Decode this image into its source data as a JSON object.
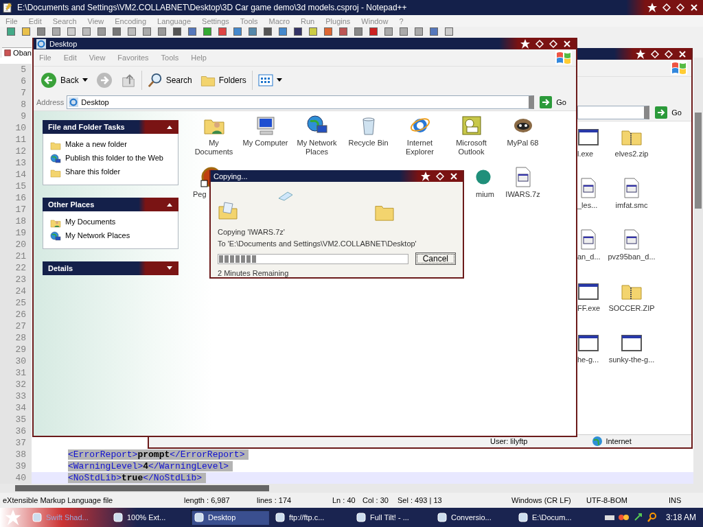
{
  "notepad": {
    "title": "E:\\Documents and Settings\\VM2.COLLABNET\\Desktop\\3D Car game demo\\3d models.csproj - Notepad++",
    "menu": [
      "File",
      "Edit",
      "Search",
      "View",
      "Encoding",
      "Language",
      "Settings",
      "Tools",
      "Macro",
      "Run",
      "Plugins",
      "Window",
      "?"
    ],
    "tab": "Oban",
    "lines": [
      {
        "number": "5",
        "current": false
      },
      {
        "number": "6",
        "current": false
      },
      {
        "number": "7",
        "current": false
      },
      {
        "number": "8",
        "current": false
      },
      {
        "number": "9",
        "current": false
      },
      {
        "number": "10",
        "current": false
      },
      {
        "number": "11",
        "current": false
      },
      {
        "number": "12",
        "current": false
      },
      {
        "number": "13",
        "current": false
      },
      {
        "number": "14",
        "current": false
      },
      {
        "number": "15",
        "current": false
      },
      {
        "number": "16",
        "current": false
      },
      {
        "number": "17",
        "current": false
      },
      {
        "number": "18",
        "current": false
      },
      {
        "number": "19",
        "current": false
      },
      {
        "number": "20",
        "current": false
      },
      {
        "number": "21",
        "current": false
      },
      {
        "number": "22",
        "current": false
      },
      {
        "number": "23",
        "current": false
      },
      {
        "number": "24",
        "current": false
      },
      {
        "number": "25",
        "current": false
      },
      {
        "number": "26",
        "current": false
      },
      {
        "number": "27",
        "current": false
      },
      {
        "number": "28",
        "current": false
      },
      {
        "number": "29",
        "current": false
      },
      {
        "number": "30",
        "current": false
      },
      {
        "number": "31",
        "current": false
      },
      {
        "number": "32",
        "current": false
      },
      {
        "number": "33",
        "current": false
      },
      {
        "number": "34",
        "current": false
      },
      {
        "number": "35",
        "current": false
      },
      {
        "number": "36",
        "current": false
      },
      {
        "number": "37",
        "current": false
      },
      {
        "number": "38",
        "selected": true,
        "current": false,
        "open_tag": "<ErrorReport>",
        "value": "prompt",
        "close_tag": "</ErrorReport>"
      },
      {
        "number": "39",
        "selected": true,
        "current": false,
        "open_tag": "<WarningLevel>",
        "value": "4",
        "close_tag": "</WarningLevel>"
      },
      {
        "number": "40",
        "selected": true,
        "current": true,
        "open_tag": "<NoStdLib>",
        "value": "true",
        "close_tag": "</NoStdLib>"
      }
    ],
    "status": [
      "eXtensible Markup Language file",
      "length : 6,987",
      "lines : 174",
      "Ln : 40",
      "Col : 30",
      "Sel : 493 | 13",
      "Windows (CR LF)",
      "UTF-8-BOM",
      "INS"
    ]
  },
  "back_window": {
    "go": "Go",
    "icons": [
      {
        "label": "l.exe",
        "kind": "program"
      },
      {
        "label": "elves2.zip",
        "kind": "zip"
      },
      {
        "label": "_les...",
        "kind": "document"
      },
      {
        "label": "imfat.smc",
        "kind": "document"
      },
      {
        "label": "an_d...",
        "kind": "document"
      },
      {
        "label": "pvz95ban_d...",
        "kind": "document"
      },
      {
        "label": "FF.exe",
        "kind": "program"
      },
      {
        "label": "SOCCER.ZIP",
        "kind": "zip"
      },
      {
        "label": "he-g...",
        "kind": "program"
      },
      {
        "label": "sunky-the-g...",
        "kind": "program"
      }
    ],
    "status": {
      "user": "User: lilyftp",
      "zone": "Internet"
    }
  },
  "explorer": {
    "title": "Desktop",
    "menu": [
      "File",
      "Edit",
      "View",
      "Favorites",
      "Tools",
      "Help"
    ],
    "toolbar": {
      "back": "Back",
      "search": "Search",
      "folders": "Folders"
    },
    "address": {
      "label": "Address",
      "value": "Desktop",
      "go": "Go"
    },
    "panels": [
      {
        "title": "File and Folder Tasks",
        "expanded": true,
        "items": [
          {
            "label": "Make a new folder",
            "kind": "folder"
          },
          {
            "label": "Publish this folder to the Web",
            "kind": "network"
          },
          {
            "label": "Share this folder",
            "kind": "folder"
          }
        ]
      },
      {
        "title": "Other Places",
        "expanded": true,
        "items": [
          {
            "label": "My Documents",
            "kind": "folder-user"
          },
          {
            "label": "My Network Places",
            "kind": "network"
          }
        ]
      },
      {
        "title": "Details",
        "expanded": false
      }
    ],
    "icons": [
      {
        "label": "My Documents",
        "kind": "folder-user"
      },
      {
        "label": "My Computer",
        "kind": "computer"
      },
      {
        "label": "My Network Places",
        "kind": "network"
      },
      {
        "label": "Recycle Bin",
        "kind": "bin"
      },
      {
        "label": "Internet Explorer",
        "kind": "browser"
      },
      {
        "label": "Microsoft Outlook",
        "kind": "outlook"
      },
      {
        "label": "MyPal 68",
        "kind": "mascot"
      }
    ],
    "icons_row_2": [
      {
        "label": "Peg",
        "kind": "ball"
      },
      {
        "label": "mium",
        "kind": "teal"
      },
      {
        "label": "IWARS.7z",
        "kind": "document"
      }
    ]
  },
  "dialog": {
    "title": "Copying...",
    "line_1": "Copying 'IWARS.7z'",
    "line_2": "To 'E:\\Documents and Settings\\VM2.COLLABNET\\Desktop'",
    "level": 0.2,
    "remaining": "2 Minutes Remaining",
    "cancel": "Cancel"
  },
  "taskbar": {
    "items": [
      {
        "label": "Swift Shad...",
        "selected": false
      },
      {
        "label": "100% Ext...",
        "selected": false
      },
      {
        "label": "Desktop",
        "selected": true
      },
      {
        "label": "ftp://ftp.c...",
        "selected": false
      },
      {
        "label": "Full Tilt! - ...",
        "selected": false
      },
      {
        "label": "Conversio...",
        "selected": false
      },
      {
        "label": "E:\\Docum...",
        "selected": false
      }
    ],
    "clock": "3:18 AM"
  }
}
